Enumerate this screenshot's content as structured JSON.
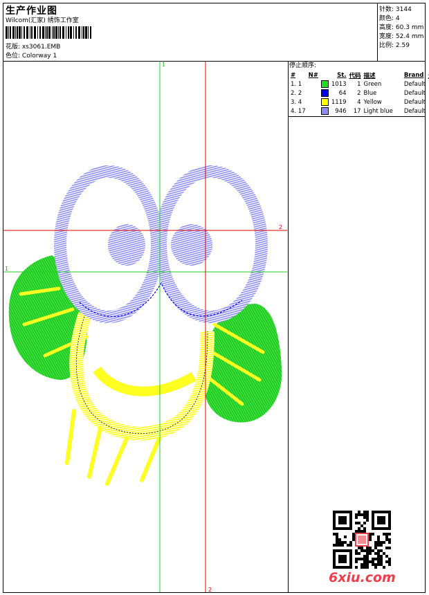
{
  "header": {
    "title": "生产作业图",
    "company": "Wilcom(汇家) 绣饰工作室",
    "design_label": "花版:",
    "design_value": "xs3061.EMB",
    "colorway_label": "色位:",
    "colorway_value": "Colorway 1"
  },
  "stats": {
    "stitches": {
      "label": "针数:",
      "value": "3144"
    },
    "colors": {
      "label": "颜色:",
      "value": "4"
    },
    "height": {
      "label": "高度:",
      "value": "60.3 mm"
    },
    "width": {
      "label": "宽度:",
      "value": "52.4 mm"
    },
    "ratio": {
      "label": "比例:",
      "value": "2.59"
    }
  },
  "stop_sequence": {
    "title": "停止顺序:",
    "headers": [
      "#",
      "N#",
      "St.",
      "代码",
      "描述",
      "Brand",
      "元素"
    ],
    "rows": [
      {
        "idx": "1. 1",
        "st": "1013",
        "code": "1",
        "desc": "Green",
        "brand": "Default",
        "color": "#22dd22"
      },
      {
        "idx": "2. 2",
        "st": "64",
        "code": "2",
        "desc": "Blue",
        "brand": "Default",
        "color": "#0000ee"
      },
      {
        "idx": "3. 4",
        "st": "1119",
        "code": "4",
        "desc": "Yellow",
        "brand": "Default",
        "color": "#ffff00"
      },
      {
        "idx": "4. 17",
        "st": "946",
        "code": "17",
        "desc": "Light blue",
        "brand": "Default",
        "color": "#8c8cf2"
      }
    ]
  },
  "guides": {
    "green_v": "1",
    "green_h": "1",
    "red_h": "2",
    "red_v": "2"
  },
  "colors": {
    "guide_green": "#22cc22",
    "guide_red": "#e00000",
    "eye_blue": "#8c8cf2",
    "leaf_green": "#22dd22",
    "smile_yellow": "#ffff22",
    "watermark_red": "#ee3e4b"
  },
  "watermark": {
    "text": "6xiu.com"
  }
}
